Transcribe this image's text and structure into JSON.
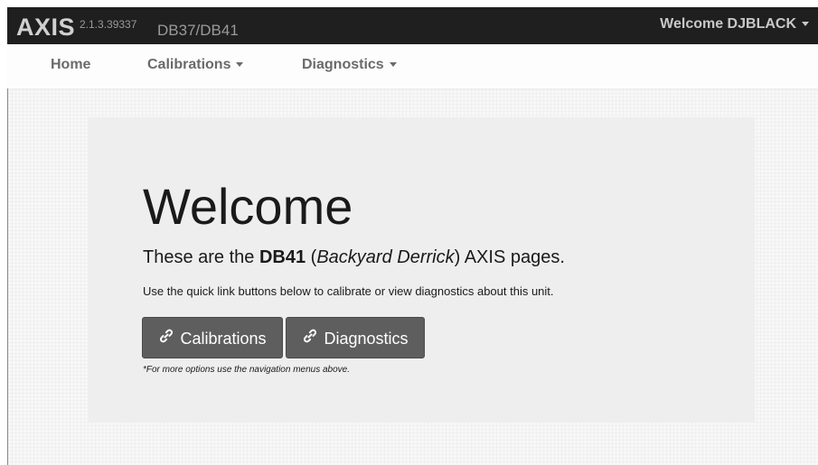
{
  "header": {
    "brand": "AXIS",
    "version": "2.1.3.39337",
    "unit_path": "DB37/DB41",
    "user_menu_label": "Welcome DJBLACK"
  },
  "nav": {
    "home": "Home",
    "calibrations": "Calibrations",
    "diagnostics": "Diagnostics"
  },
  "main": {
    "heading": "Welcome",
    "lead_prefix": "These are the ",
    "lead_unit": "DB41",
    "lead_open": " (",
    "lead_name": "Backyard Derrick",
    "lead_suffix": ") AXIS pages.",
    "description": "Use the quick link buttons below to calibrate or view diagnostics about this unit.",
    "buttons": {
      "calibrations": "Calibrations",
      "diagnostics": "Diagnostics"
    },
    "footnote": "*For more options use the navigation menus above."
  },
  "icons": {
    "button_icon": "link-icon",
    "menu_caret": "caret-down-icon"
  },
  "colors": {
    "topbar_bg": "#1f1f1f",
    "button_bg": "#5e5e5e",
    "jumbotron_bg": "#eeeeee"
  }
}
